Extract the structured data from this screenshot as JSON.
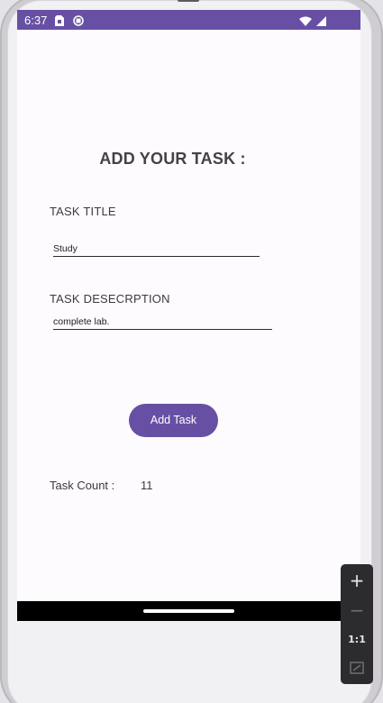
{
  "status_bar": {
    "time": "6:37",
    "icons": [
      "sim-card-icon",
      "notification-icon",
      "wifi-icon",
      "cell-signal-icon"
    ],
    "color": "#6750a4"
  },
  "page": {
    "heading": "ADD YOUR TASK :"
  },
  "form": {
    "title_label": "TASK TITLE",
    "title_value": "Study",
    "description_label": "TASK DESECRPTION",
    "description_value": "complete lab."
  },
  "actions": {
    "add_button_label": "Add Task",
    "accent_color": "#6750a4"
  },
  "stats": {
    "count_label": "Task Count :",
    "count_value": "11"
  },
  "emulator_toolbar": {
    "zoom_in": "+",
    "zoom_out": "−",
    "reset": "1:1",
    "fit_icon": "fit-screen-icon"
  }
}
